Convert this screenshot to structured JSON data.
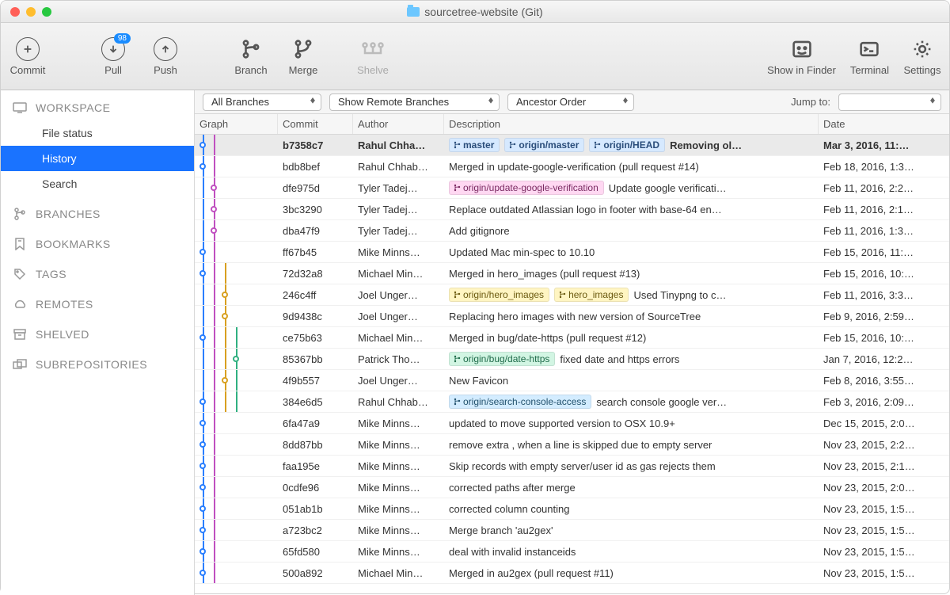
{
  "window": {
    "title": "sourcetree-website (Git)"
  },
  "toolbar": {
    "commit": "Commit",
    "pull": "Pull",
    "pull_badge": "98",
    "push": "Push",
    "branch": "Branch",
    "merge": "Merge",
    "shelve": "Shelve",
    "show_in_finder": "Show in Finder",
    "terminal": "Terminal",
    "settings": "Settings"
  },
  "sidebar": {
    "workspace": {
      "label": "WORKSPACE",
      "file_status": "File status",
      "history": "History",
      "search": "Search"
    },
    "branches": "BRANCHES",
    "bookmarks": "BOOKMARKS",
    "tags": "TAGS",
    "remotes": "REMOTES",
    "shelved": "SHELVED",
    "subrepos": "SUBREPOSITORIES"
  },
  "filters": {
    "branch": "All Branches",
    "remote": "Show Remote Branches",
    "order": "Ancestor Order",
    "jump_label": "Jump to:"
  },
  "columns": {
    "graph": "Graph",
    "commit": "Commit",
    "author": "Author",
    "description": "Description",
    "date": "Date"
  },
  "commits": [
    {
      "hash": "b7358c7",
      "author": "Rahul Chha…",
      "desc": "Removing ol…",
      "date": "Mar 3, 2016, 11:…",
      "selected": true,
      "tags": [
        {
          "label": "master",
          "style": "bt-blue"
        },
        {
          "label": "origin/master",
          "style": "bt-blue"
        },
        {
          "label": "origin/HEAD",
          "style": "bt-blue"
        }
      ],
      "dot": 0
    },
    {
      "hash": "bdb8bef",
      "author": "Rahul Chhab…",
      "desc": "Merged in update-google-verification (pull request #14)",
      "date": "Feb 18, 2016, 1:3…",
      "dot": 0
    },
    {
      "hash": "dfe975d",
      "author": "Tyler Tadej…",
      "desc": "Update google verificati…",
      "date": "Feb 11, 2016, 2:2…",
      "tags": [
        {
          "label": "origin/update-google-verification",
          "style": "bt-pink"
        }
      ],
      "dot": 1
    },
    {
      "hash": "3bc3290",
      "author": "Tyler Tadej…",
      "desc": "Replace outdated Atlassian logo in footer with base-64 en…",
      "date": "Feb 11, 2016, 2:1…",
      "dot": 1
    },
    {
      "hash": "dba47f9",
      "author": "Tyler Tadej…",
      "desc": "Add gitignore",
      "date": "Feb 11, 2016, 1:3…",
      "dot": 1
    },
    {
      "hash": "ff67b45",
      "author": "Mike Minns…",
      "desc": "Updated Mac min-spec to 10.10",
      "date": "Feb 15, 2016, 11:…",
      "dot": 0
    },
    {
      "hash": "72d32a8",
      "author": "Michael Min…",
      "desc": "Merged in hero_images (pull request #13)",
      "date": "Feb 15, 2016, 10:…",
      "dot": 0
    },
    {
      "hash": "246c4ff",
      "author": "Joel Unger…",
      "desc": "Used Tinypng to c…",
      "date": "Feb 11, 2016, 3:3…",
      "tags": [
        {
          "label": "origin/hero_images",
          "style": "bt-yellow"
        },
        {
          "label": "hero_images",
          "style": "bt-yellow"
        }
      ],
      "dot": 2
    },
    {
      "hash": "9d9438c",
      "author": "Joel Unger…",
      "desc": "Replacing hero images with new version of SourceTree",
      "date": "Feb 9, 2016, 2:59…",
      "dot": 2
    },
    {
      "hash": "ce75b63",
      "author": "Michael Min…",
      "desc": "Merged in bug/date-https (pull request #12)",
      "date": "Feb 15, 2016, 10:…",
      "dot": 0
    },
    {
      "hash": "85367bb",
      "author": "Patrick Tho…",
      "desc": "fixed date and https errors",
      "date": "Jan 7, 2016, 12:2…",
      "tags": [
        {
          "label": "origin/bug/date-https",
          "style": "bt-green"
        }
      ],
      "dot": 3
    },
    {
      "hash": "4f9b557",
      "author": "Joel Unger…",
      "desc": "New Favicon",
      "date": "Feb 8, 2016, 3:55…",
      "dot": 2
    },
    {
      "hash": "384e6d5",
      "author": "Rahul Chhab…",
      "desc": "search console google ver…",
      "date": "Feb 3, 2016, 2:09…",
      "tags": [
        {
          "label": "origin/search-console-access",
          "style": "bt-lblue"
        }
      ],
      "dot": 0
    },
    {
      "hash": "6fa47a9",
      "author": "Mike Minns…",
      "desc": "updated to move supported version to OSX 10.9+",
      "date": "Dec 15, 2015, 2:0…",
      "dot": 0
    },
    {
      "hash": "8dd87bb",
      "author": "Mike Minns…",
      "desc": "remove extra , when a line is skipped due to empty server",
      "date": "Nov 23, 2015, 2:2…",
      "dot": 0
    },
    {
      "hash": "faa195e",
      "author": "Mike Minns…",
      "desc": "Skip records with empty server/user id as gas rejects them",
      "date": "Nov 23, 2015, 2:1…",
      "dot": 0
    },
    {
      "hash": "0cdfe96",
      "author": "Mike Minns…",
      "desc": "corrected paths after merge",
      "date": "Nov 23, 2015, 2:0…",
      "dot": 0
    },
    {
      "hash": "051ab1b",
      "author": "Mike Minns…",
      "desc": " corrected column counting",
      "date": "Nov 23, 2015, 1:5…",
      "dot": 0
    },
    {
      "hash": "a723bc2",
      "author": "Mike Minns…",
      "desc": "Merge branch 'au2gex'",
      "date": "Nov 23, 2015, 1:5…",
      "dot": 0
    },
    {
      "hash": "65fd580",
      "author": "Mike Minns…",
      "desc": "deal with invalid instanceids",
      "date": "Nov 23, 2015, 1:5…",
      "dot": 0
    },
    {
      "hash": "500a892",
      "author": "Michael Min…",
      "desc": "Merged in au2gex (pull request #11)",
      "date": "Nov 23, 2015, 1:5…",
      "dot": 0
    }
  ]
}
